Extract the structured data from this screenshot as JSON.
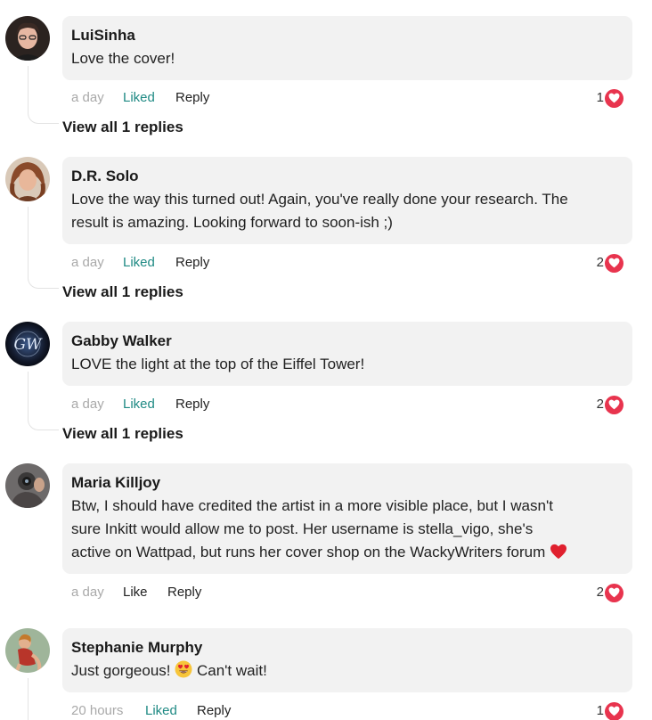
{
  "comments": [
    {
      "author": "LuiSinha",
      "text": "Love the cover!",
      "time": "a day",
      "like_label": "Liked",
      "reply_label": "Reply",
      "likes": "1",
      "view_replies": "View all 1 replies"
    },
    {
      "author": "D.R. Solo",
      "text_lines": [
        "Love the way this turned out! Again, you've really done your research. The",
        "result is amazing. Looking forward to soon-ish ;)"
      ],
      "time": "a day",
      "like_label": "Liked",
      "reply_label": "Reply",
      "likes": "2",
      "view_replies": "View all 1 replies"
    },
    {
      "author": "Gabby Walker",
      "text": "LOVE the light at the top of the Eiffel Tower!",
      "time": "a day",
      "like_label": "Liked",
      "reply_label": "Reply",
      "likes": "2",
      "view_replies": "View all 1 replies",
      "avatar_text": "GW"
    },
    {
      "author": "Maria Killjoy",
      "text_lines": [
        "Btw, I should have credited the artist in a more visible place, but I wasn't",
        "sure Inkitt would allow me to post. Her username is stella_vigo, she's",
        "active on Wattpad, but runs her cover shop on the WackyWriters forum"
      ],
      "time": "a day",
      "like_label": "Like",
      "reply_label": "Reply",
      "likes": "2",
      "trailing_emoji": "red-heart-emoji"
    },
    {
      "author": "Stephanie Murphy",
      "text_before_emoji": "Just gorgeous!",
      "text_after_emoji": "Can't wait!",
      "emoji": "heart-eyes-emoji",
      "time": "20 hours",
      "like_label": "Liked",
      "reply_label": "Reply",
      "likes": "1"
    }
  ],
  "colors": {
    "bubble": "#f2f2f2",
    "liked": "#1f8a84",
    "time": "#a9a9a9",
    "heart": "#e8344e"
  }
}
